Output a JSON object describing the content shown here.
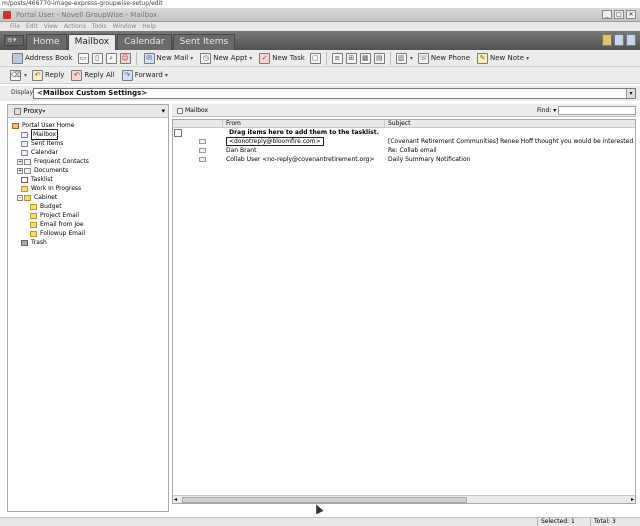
{
  "url_bar": "m/posts/466770-image-express-groupwise-setup/edit",
  "window": {
    "title": "Portal User - Novell GroupWise - Mailbox"
  },
  "menu": [
    "File",
    "Edit",
    "View",
    "Actions",
    "Tools",
    "Window",
    "Help"
  ],
  "tabs": [
    {
      "label": "Home",
      "active": false
    },
    {
      "label": "Mailbox",
      "active": true
    },
    {
      "label": "Calendar",
      "active": false
    },
    {
      "label": "Sent Items",
      "active": false
    }
  ],
  "toolbar1": {
    "address_book": "Address Book",
    "new_mail": "New Mail",
    "new_appt": "New Appt",
    "new_task": "New Task",
    "new_phone": "New Phone",
    "new_note": "New Note"
  },
  "toolbar2": {
    "reply": "Reply",
    "reply_all": "Reply All",
    "forward": "Forward"
  },
  "display": {
    "label": "Display",
    "value": "<Mailbox Custom Settings>"
  },
  "left": {
    "proxy": "Proxy",
    "tree": [
      {
        "label": "Portal User Home",
        "level": 0,
        "icon": "home-icon"
      },
      {
        "label": "Mailbox",
        "level": 1,
        "icon": "mailbox-icon",
        "selected": true
      },
      {
        "label": "Sent Items",
        "level": 1,
        "icon": "sent-items-icon"
      },
      {
        "label": "Calendar",
        "level": 1,
        "icon": "calendar-icon"
      },
      {
        "label": "Frequent Contacts",
        "level": 1,
        "icon": "contacts-icon",
        "expand": "+"
      },
      {
        "label": "Documents",
        "level": 1,
        "icon": "documents-icon",
        "expand": "+"
      },
      {
        "label": "Tasklist",
        "level": 1,
        "icon": "tasklist-icon"
      },
      {
        "label": "Work In Progress",
        "level": 1,
        "icon": "folder-icon"
      },
      {
        "label": "Cabinet",
        "level": 1,
        "icon": "cabinet-icon",
        "expand": "-"
      },
      {
        "label": "Budget",
        "level": 2,
        "icon": "folder-icon"
      },
      {
        "label": "Project Email",
        "level": 2,
        "icon": "folder-icon"
      },
      {
        "label": "Email from Joe",
        "level": 2,
        "icon": "folder-icon"
      },
      {
        "label": "Followup Email",
        "level": 2,
        "icon": "folder-icon"
      },
      {
        "label": "Trash",
        "level": 1,
        "icon": "trash-icon"
      }
    ]
  },
  "main": {
    "header_title": "Mailbox",
    "find_label": "Find:",
    "columns": {
      "from": "From",
      "subject": "Subject"
    },
    "drag_hint": "Drag items here to add them to the tasklist.",
    "messages": [
      {
        "from": "<donotreply@bloomfire.com>",
        "subject": "[Covenant Retirement Communities] Renee Hoff thought you would be interested in this pos",
        "selected": true
      },
      {
        "from": "Dan Brant",
        "subject": "Re: Collab email",
        "selected": false
      },
      {
        "from": "Collab User <no-reply@covenantretirement.org>",
        "subject": "Daily Summary Notification",
        "selected": false
      }
    ]
  },
  "status": {
    "selected": "Selected: 1",
    "total": "Total: 3"
  }
}
